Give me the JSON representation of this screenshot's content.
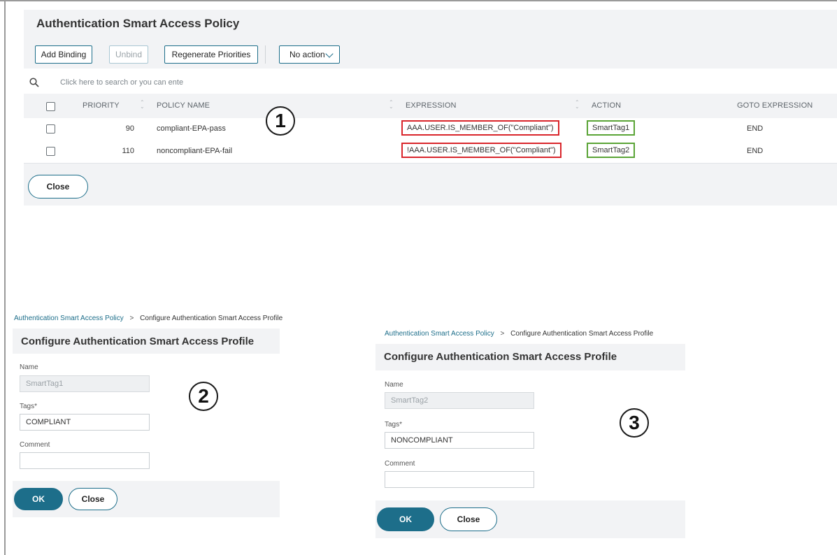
{
  "policy_panel": {
    "title": "Authentication Smart Access Policy",
    "toolbar": {
      "add_binding": "Add Binding",
      "unbind": "Unbind",
      "regenerate": "Regenerate Priorities",
      "action_select": "No action"
    },
    "search_placeholder": "Click here to search or you can ente",
    "columns": [
      "PRIORITY",
      "POLICY NAME",
      "EXPRESSION",
      "ACTION",
      "GOTO EXPRESSION"
    ],
    "rows": [
      {
        "priority": "90",
        "policy_name": "compliant-EPA-pass",
        "expression": "AAA.USER.IS_MEMBER_OF(\"Compliant\")",
        "action": "SmartTag1",
        "goto": "END"
      },
      {
        "priority": "110",
        "policy_name": "noncompliant-EPA-fail",
        "expression": "!AAA.USER.IS_MEMBER_OF(\"Compliant\")",
        "action": "SmartTag2",
        "goto": "END"
      }
    ],
    "close_label": "Close",
    "callout": "1"
  },
  "profile_panels": [
    {
      "breadcrumb_link": "Authentication Smart Access Policy",
      "breadcrumb_separator": ">",
      "breadcrumb_current": "Configure Authentication Smart Access Profile",
      "title": "Configure Authentication Smart Access Profile",
      "name_label": "Name",
      "name_value": "SmartTag1",
      "tags_label": "Tags*",
      "tags_value": "COMPLIANT",
      "comment_label": "Comment",
      "comment_value": "",
      "ok_label": "OK",
      "close_label": "Close",
      "callout": "2"
    },
    {
      "breadcrumb_link": "Authentication Smart Access Policy",
      "breadcrumb_separator": ">",
      "breadcrumb_current": "Configure Authentication Smart Access Profile",
      "title": "Configure Authentication Smart Access Profile",
      "name_label": "Name",
      "name_value": "SmartTag2",
      "tags_label": "Tags*",
      "tags_value": "NONCOMPLIANT",
      "comment_label": "Comment",
      "comment_value": "",
      "ok_label": "OK",
      "close_label": "Close",
      "callout": "3"
    }
  ],
  "colors": {
    "accent": "#1d6e8a",
    "expression_highlight": "#d9252b",
    "action_highlight": "#5aa436",
    "panel_bg": "#f2f3f5"
  }
}
